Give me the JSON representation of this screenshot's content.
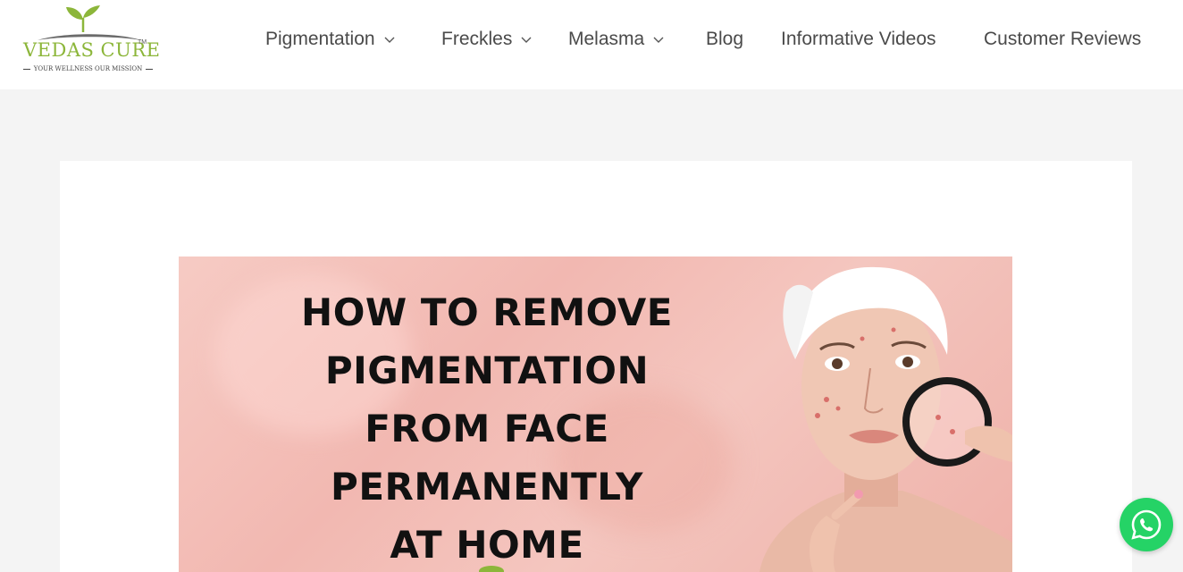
{
  "brand": {
    "name": "VEDAS CURE",
    "trademark": "TM",
    "tagline": "YOUR WELLNESS OUR MISSION",
    "green": "#8cb63a"
  },
  "nav": {
    "items": [
      {
        "label": "Pigmentation",
        "has_dropdown": true
      },
      {
        "label": "Freckles",
        "has_dropdown": true
      },
      {
        "label": "Melasma",
        "has_dropdown": true
      },
      {
        "label": "Blog",
        "has_dropdown": false
      },
      {
        "label": "Informative Videos",
        "has_dropdown": false
      },
      {
        "label": "Customer Reviews",
        "has_dropdown": false
      }
    ]
  },
  "hero": {
    "title_lines": [
      "HOW TO REMOVE",
      "PIGMENTATION",
      "FROM FACE",
      "PERMANENTLY",
      "AT HOME"
    ],
    "background_color": "#f4c2bb"
  },
  "floating": {
    "whatsapp_icon": "whatsapp-icon",
    "color": "#25d366"
  }
}
